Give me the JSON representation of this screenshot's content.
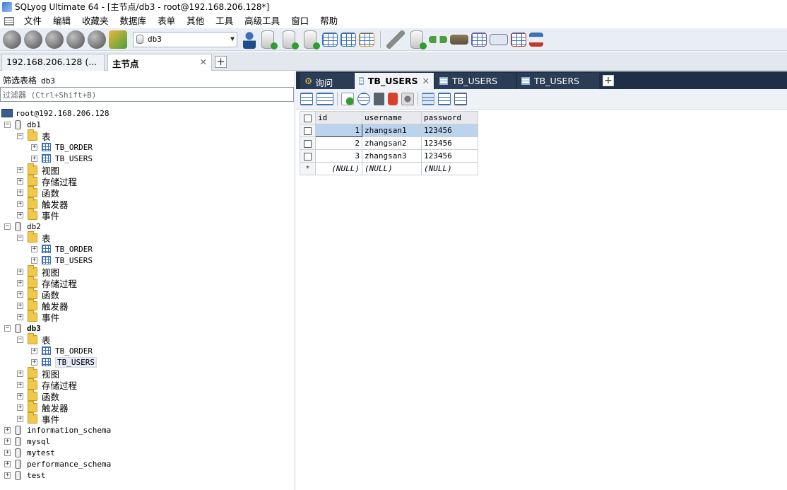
{
  "window": {
    "title": "SQLyog Ultimate 64 - [主节点/db3 - root@192.168.206.128*]"
  },
  "menu": [
    "文件",
    "编辑",
    "收藏夹",
    "数据库",
    "表单",
    "其他",
    "工具",
    "高级工具",
    "窗口",
    "帮助"
  ],
  "toolbar": {
    "db_select": "db3"
  },
  "conn_tabs": [
    {
      "label": "192.168.206.128 (...",
      "active": false
    },
    {
      "label": "主节点",
      "active": true
    }
  ],
  "left": {
    "filter_label": "筛选表格",
    "filter_db": "db3",
    "filter_placeholder": "过滤器 (Ctrl+Shift+B)",
    "root": "root@192.168.206.128",
    "databases": [
      {
        "name": "db1",
        "tables_label": "表",
        "tables": [
          "TB_ORDER",
          "TB_USERS"
        ],
        "folders": [
          "视图",
          "存储过程",
          "函数",
          "触发器",
          "事件"
        ]
      },
      {
        "name": "db2",
        "tables_label": "表",
        "tables": [
          "TB_ORDER",
          "TB_USERS"
        ],
        "folders": [
          "视图",
          "存储过程",
          "函数",
          "触发器",
          "事件"
        ]
      },
      {
        "name": "db3",
        "tables_label": "表",
        "tables": [
          "TB_ORDER",
          "TB_USERS"
        ],
        "folders": [
          "视图",
          "存储过程",
          "函数",
          "触发器",
          "事件"
        ]
      }
    ],
    "other_databases": [
      "information_schema",
      "mysql",
      "mytest",
      "performance_schema",
      "test"
    ]
  },
  "query_tabs": [
    {
      "label": "询问",
      "active": false
    },
    {
      "label": "TB_USERS",
      "active": true
    },
    {
      "label": "TB_USERS",
      "active": false
    },
    {
      "label": "TB_USERS",
      "active": false
    }
  ],
  "grid": {
    "columns": [
      "id",
      "username",
      "password"
    ],
    "rows": [
      {
        "id": "1",
        "username": "zhangsan1",
        "password": "123456"
      },
      {
        "id": "2",
        "username": "zhangsan2",
        "password": "123456"
      },
      {
        "id": "3",
        "username": "zhangsan3",
        "password": "123456"
      }
    ],
    "new_row": {
      "marker": "*",
      "id": "(NULL)",
      "username": "(NULL)",
      "password": "(NULL)"
    }
  }
}
